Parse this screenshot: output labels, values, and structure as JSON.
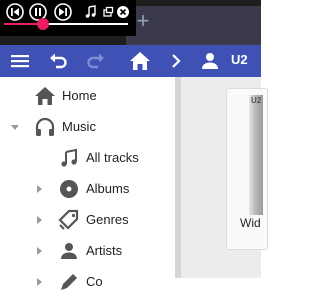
{
  "toolbar": {
    "user_label": "U2"
  },
  "sidebar": {
    "items": [
      {
        "label": "Home"
      },
      {
        "label": "Music"
      },
      {
        "label": "All tracks"
      },
      {
        "label": "Albums"
      },
      {
        "label": "Genres"
      },
      {
        "label": "Artists"
      },
      {
        "label": "Co"
      }
    ]
  },
  "content": {
    "card_title": "Wid",
    "art_text": "U2"
  },
  "colors": {
    "toolbar": "#3f51b5",
    "seek_accent": "#e91e63",
    "tab_bg": "#3a3a4a"
  }
}
